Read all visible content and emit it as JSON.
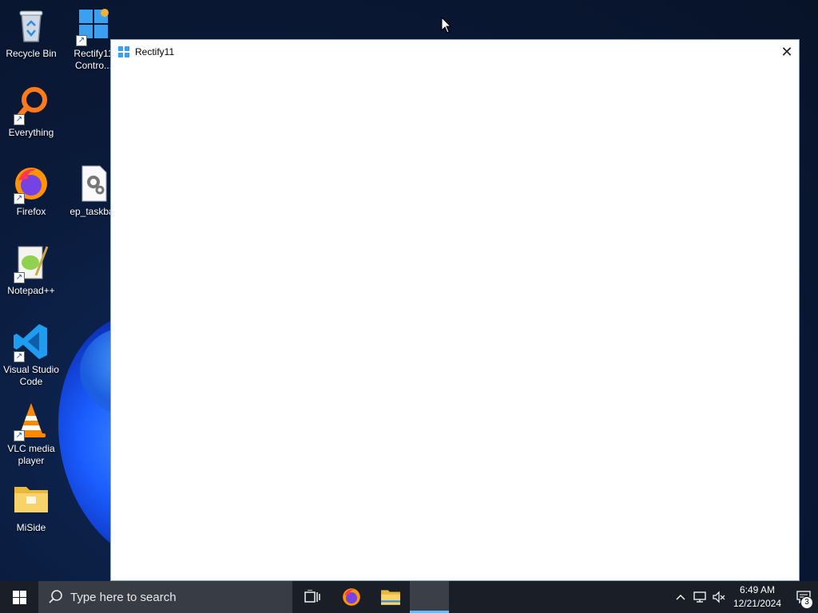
{
  "desktop": {
    "icons": [
      {
        "label": "Recycle Bin",
        "icon": "recycle-bin-icon"
      },
      {
        "label": "Rectify11 Contro...",
        "icon": "control-center-icon"
      },
      {
        "label": "Everything",
        "icon": "everything-search-icon"
      },
      {
        "label": "Firefox",
        "icon": "firefox-icon"
      },
      {
        "label": "ep_taskbar",
        "icon": "settings-file-icon"
      },
      {
        "label": "Notepad++",
        "icon": "notepad-plus-plus-icon"
      },
      {
        "label": "Visual Studio Code",
        "icon": "vscode-icon"
      },
      {
        "label": "VLC media player",
        "icon": "vlc-icon"
      },
      {
        "label": "MiSide",
        "icon": "folder-icon"
      }
    ]
  },
  "window": {
    "title": "Rectify11",
    "close_glyph": "✕"
  },
  "taskbar": {
    "search_placeholder": "Type here to search",
    "clock_time": "6:49 AM",
    "clock_date": "12/21/2024",
    "notification_count": "3",
    "tray_chevron": "^"
  },
  "colors": {
    "accent": "#6cb8f6",
    "taskbar_bg": "#1a1e26",
    "search_bg": "#383c44"
  }
}
